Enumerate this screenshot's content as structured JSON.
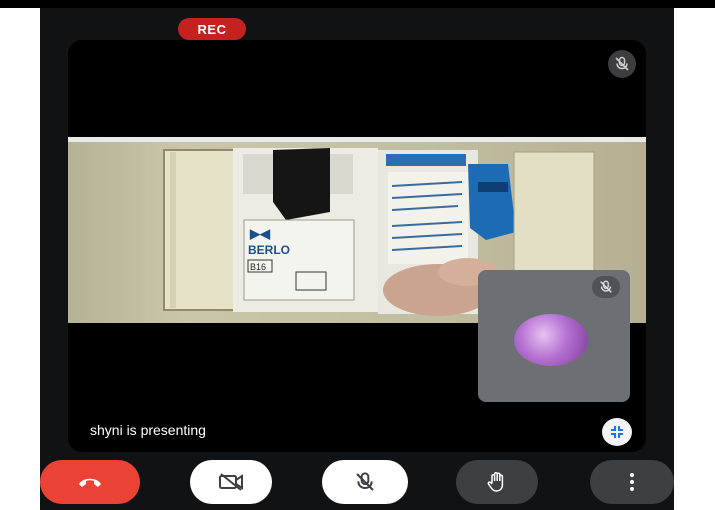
{
  "recording": {
    "badge_label": "REC"
  },
  "presentation": {
    "status_text": "shyni is presenting"
  },
  "shared_screen": {
    "breaker_brand": "BERLO",
    "breaker_rating": "B16"
  },
  "controls": {
    "end_call": "end-call",
    "camera": "camera-off",
    "microphone": "mic-off",
    "raise_hand": "hand",
    "more": "more-options"
  },
  "colors": {
    "rec": "#c5221f",
    "end_call": "#ea4335",
    "control_dark": "#3c4043",
    "app_background": "#111214"
  }
}
